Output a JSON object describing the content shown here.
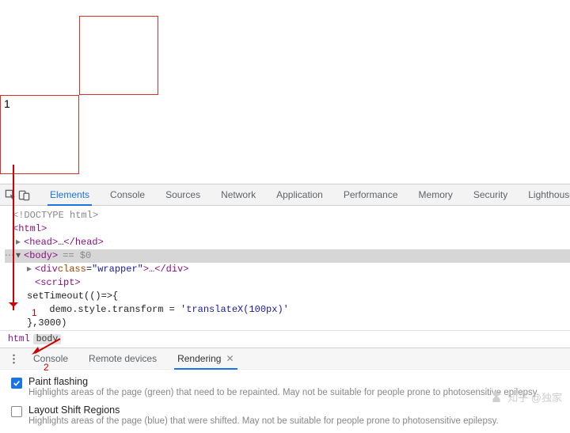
{
  "page": {
    "box_b_number": "1"
  },
  "overlay": {
    "num_crumb": "1",
    "num_opt": "2"
  },
  "toolbar": {
    "tabs": [
      "Elements",
      "Console",
      "Sources",
      "Network",
      "Application",
      "Performance",
      "Memory",
      "Security",
      "Lighthouse"
    ],
    "active_index": 0
  },
  "dom": {
    "doctype": "<!DOCTYPE html>",
    "html_open": "<html>",
    "head": {
      "open": "<head>",
      "ellipsis": "…",
      "close": "</head>"
    },
    "body": {
      "open": "<body>",
      "sel_annot": "== $0",
      "div_open_bkt": "<",
      "div_name": "div",
      "div_attr_n": "class",
      "div_attr_v": "\"wrapper\"",
      "div_mid": ">…</",
      "div_close_name": "div",
      "div_close_bkt": ">",
      "script_open": "<script>",
      "line1": "setTimeout(()=>{",
      "line2": "  demo.style.transform = 'translateX(100px)'",
      "line3": "},3000)"
    }
  },
  "crumbs": {
    "a": "html",
    "b": "body"
  },
  "drawer": {
    "tabs": [
      "Console",
      "Remote devices",
      "Rendering"
    ],
    "active_index": 2,
    "options": [
      {
        "checked": true,
        "title": "Paint flashing",
        "desc": "Highlights areas of the page (green) that need to be repainted. May not be suitable for people prone to photosensitive epilepsy."
      },
      {
        "checked": false,
        "title": "Layout Shift Regions",
        "desc": "Highlights areas of the page (blue) that were shifted. May not be suitable for people prone to photosensitive epilepsy."
      }
    ]
  },
  "watermark": "知乎 @独家"
}
